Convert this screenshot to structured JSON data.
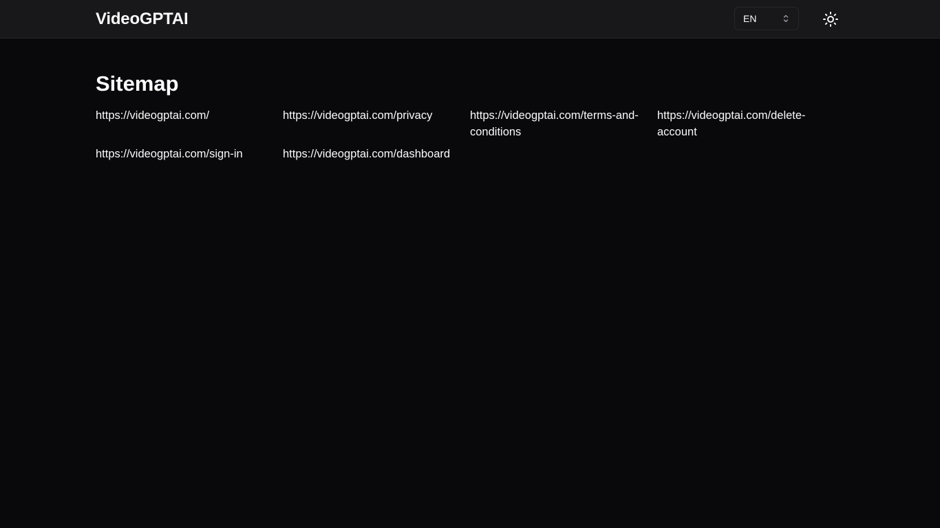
{
  "header": {
    "brand": "VideoGPTAI",
    "language": {
      "selected": "EN"
    },
    "theme_icon": "sun-icon"
  },
  "main": {
    "title": "Sitemap",
    "links": [
      "https://videogptai.com/",
      "https://videogptai.com/privacy",
      "https://videogptai.com/terms-and-conditions",
      "https://videogptai.com/delete-account",
      "https://videogptai.com/sign-in",
      "https://videogptai.com/dashboard"
    ]
  },
  "colors": {
    "background": "#09090b",
    "header_background": "#18181b",
    "border": "#27272a",
    "text": "#fafafa"
  }
}
